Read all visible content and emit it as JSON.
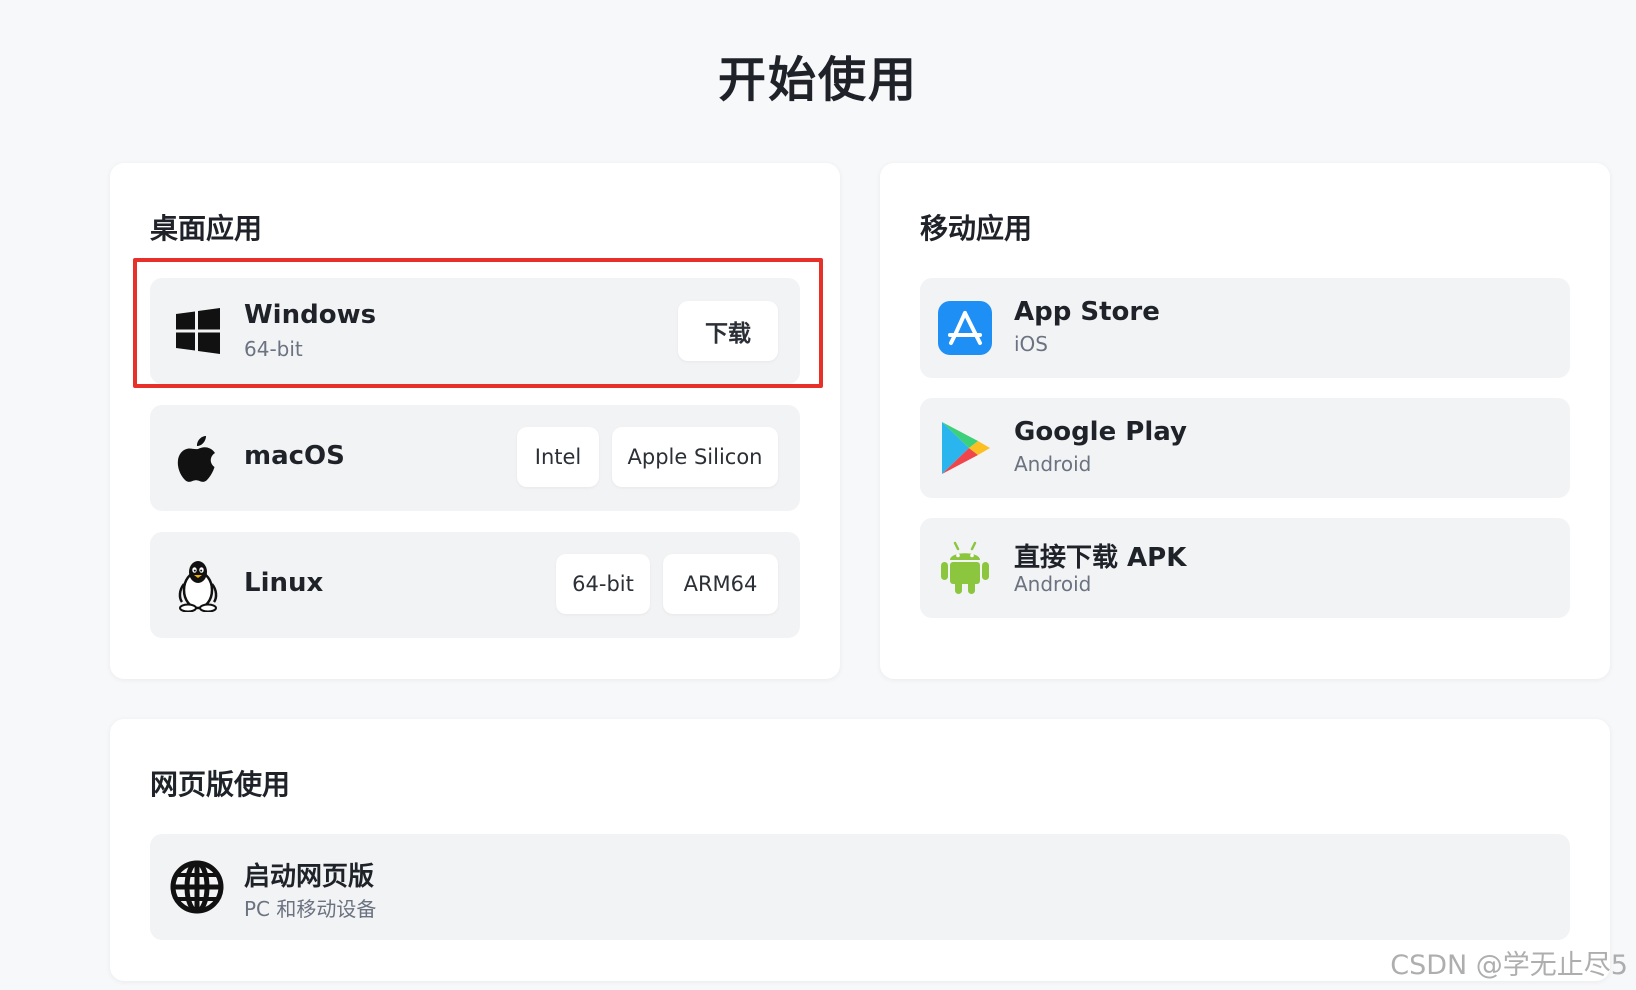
{
  "page_title": "开始使用",
  "desktop": {
    "title": "桌面应用",
    "windows": {
      "name": "Windows",
      "sub": "64-bit",
      "download_label": "下载"
    },
    "macos": {
      "name": "macOS",
      "intel_label": "Intel",
      "silicon_label": "Apple Silicon"
    },
    "linux": {
      "name": "Linux",
      "x64_label": "64-bit",
      "arm_label": "ARM64"
    }
  },
  "mobile": {
    "title": "移动应用",
    "appstore": {
      "name": "App Store",
      "sub": "iOS"
    },
    "googleplay": {
      "name": "Google Play",
      "sub": "Android"
    },
    "apk": {
      "name": "直接下载 APK",
      "sub": "Android"
    }
  },
  "web": {
    "title": "网页版使用",
    "launch": {
      "name": "启动网页版",
      "sub": "PC 和移动设备"
    }
  },
  "icons": {
    "windows": "windows-icon",
    "macos": "apple-icon",
    "linux": "linux-penguin-icon",
    "appstore": "app-store-icon",
    "googleplay": "google-play-icon",
    "android": "android-icon",
    "web": "globe-icon"
  },
  "colors": {
    "highlight_border": "#e8302a",
    "appstore_blue": "#1e90f5",
    "android_green": "#8cc63f"
  },
  "watermark": "CSDN @学无止尽5"
}
